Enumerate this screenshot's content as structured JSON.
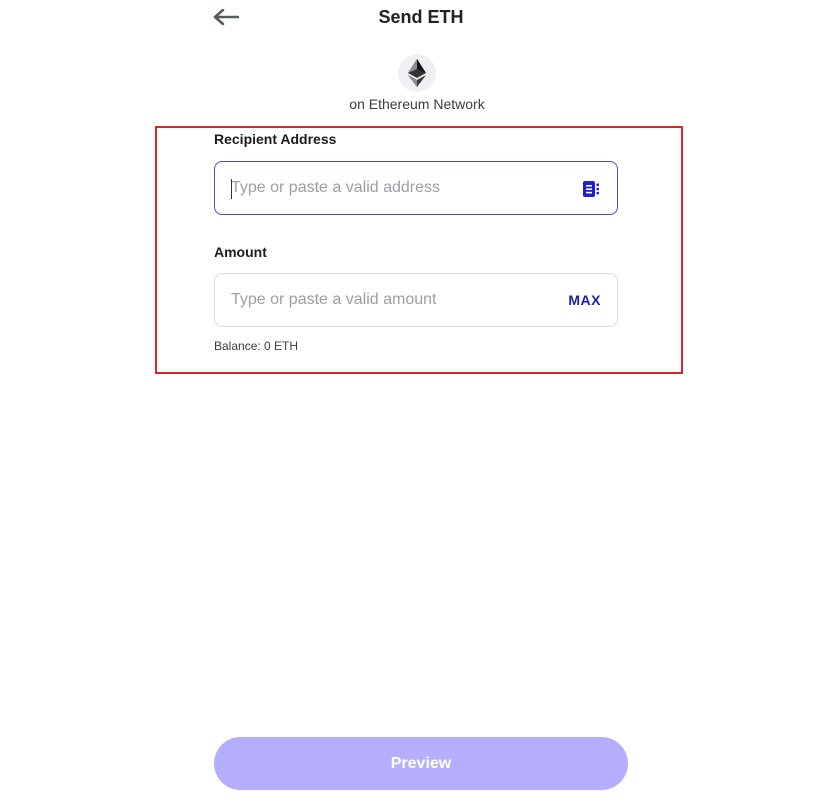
{
  "header": {
    "title": "Send ETH",
    "back_icon": "arrow-left-icon"
  },
  "asset": {
    "logo_icon": "ethereum-logo-icon",
    "network_text": "on Ethereum Network"
  },
  "form": {
    "recipient": {
      "label": "Recipient Address",
      "placeholder": "Type or paste a valid address",
      "value": "",
      "icon": "address-book-icon"
    },
    "amount": {
      "label": "Amount",
      "placeholder": "Type or paste a valid amount",
      "value": "",
      "max_label": "MAX"
    },
    "balance_text": "Balance: 0 ETH"
  },
  "footer": {
    "preview_label": "Preview",
    "preview_disabled": true
  },
  "colors": {
    "accent": "#5449cf",
    "button_disabled": "#b4aefc",
    "max_text": "#1f1db0",
    "highlight_border": "#d6262e"
  }
}
